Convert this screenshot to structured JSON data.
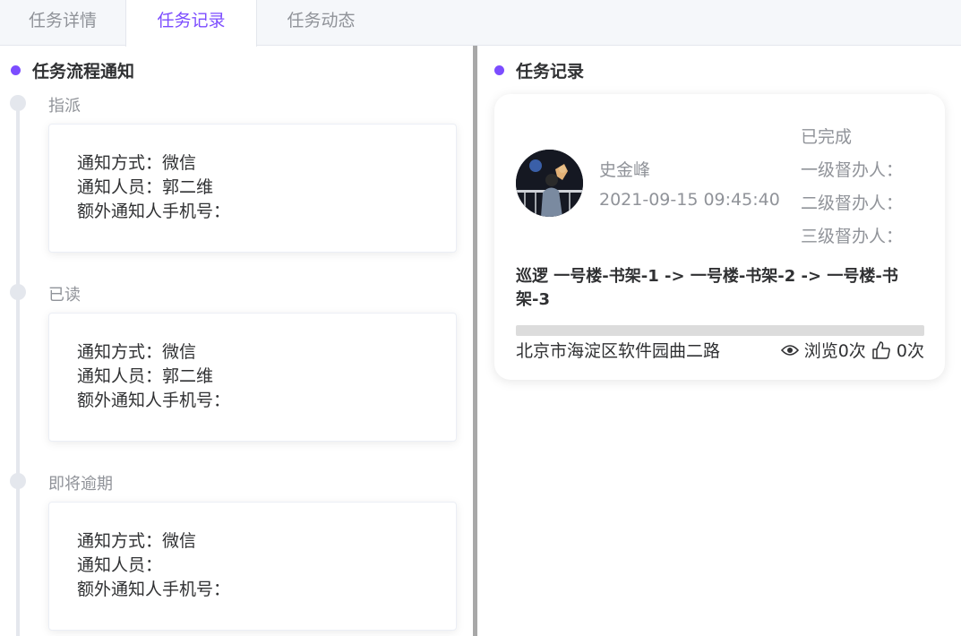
{
  "tabs": [
    {
      "label": "任务详情",
      "active": false
    },
    {
      "label": "任务记录",
      "active": true
    },
    {
      "label": "任务动态",
      "active": false
    }
  ],
  "left": {
    "title": "任务流程通知",
    "events": [
      {
        "label": "指派",
        "method": "通知方式：微信",
        "person": "通知人员：郭二维",
        "extra": "额外通知人手机号："
      },
      {
        "label": "已读",
        "method": "通知方式：微信",
        "person": "通知人员：郭二维",
        "extra": "额外通知人手机号："
      },
      {
        "label": "即将逾期",
        "method": "通知方式：微信",
        "person": "通知人员：",
        "extra": "额外通知人手机号："
      }
    ]
  },
  "right": {
    "title": "任务记录",
    "record": {
      "user_name": "史金峰",
      "time": "2021-09-15 09:45:40",
      "status": "已完成",
      "supervisors": [
        "一级督办人：",
        "二级督办人：",
        "三级督办人："
      ],
      "route": "巡逻 一号楼-书架-1 -> 一号楼-书架-2 -> 一号楼-书架-3",
      "address": "北京市海淀区软件园曲二路",
      "views": "浏览0次",
      "likes": "0次",
      "progress": 0
    }
  },
  "colors": {
    "accent": "#7c4dff",
    "muted": "#909399",
    "text": "#303133"
  }
}
